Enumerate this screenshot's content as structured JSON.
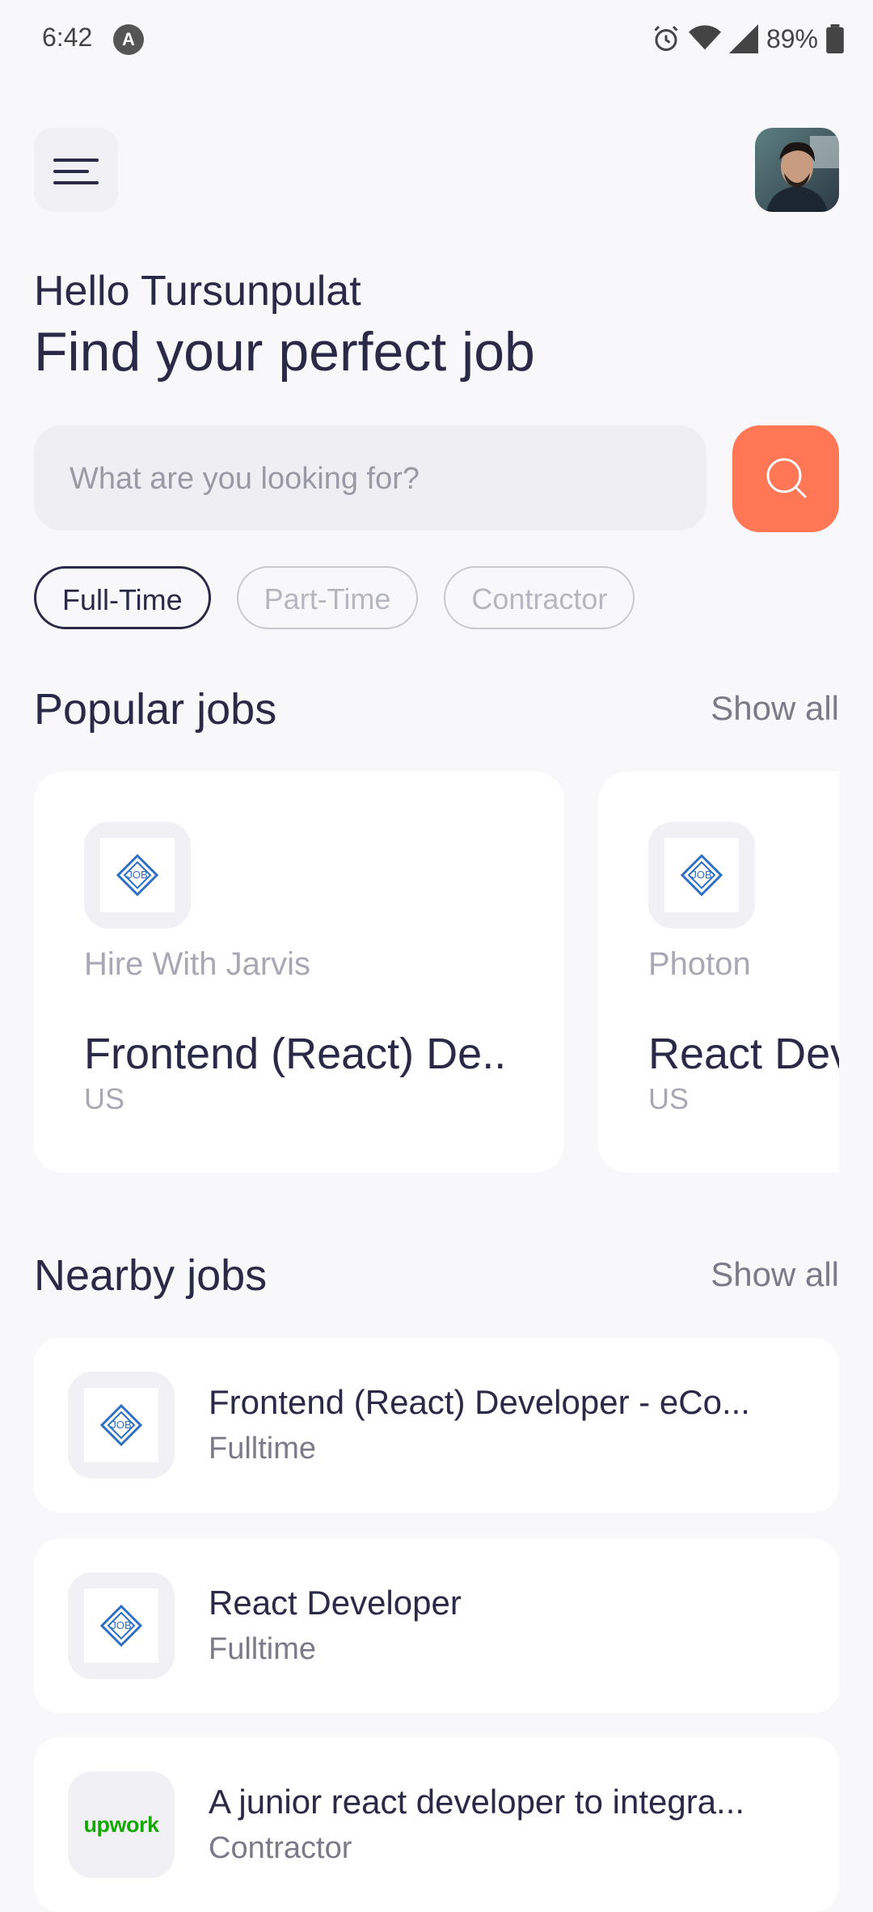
{
  "status_bar": {
    "time": "6:42",
    "battery": "89%"
  },
  "greeting": "Hello Tursunpulat",
  "headline": "Find your perfect job",
  "search": {
    "placeholder": "What are you looking for?"
  },
  "job_types": [
    {
      "label": "Full-Time",
      "active": true
    },
    {
      "label": "Part-Time",
      "active": false
    },
    {
      "label": "Contractor",
      "active": false
    }
  ],
  "popular": {
    "title": "Popular jobs",
    "show_all": "Show all",
    "cards": [
      {
        "company": "Hire With Jarvis",
        "title": "Frontend (React) De..",
        "location": "US"
      },
      {
        "company": "Photon",
        "title": "React Developer",
        "location": "US"
      }
    ]
  },
  "nearby": {
    "title": "Nearby jobs",
    "show_all": "Show all",
    "items": [
      {
        "title": "Frontend (React) Developer - eCo...",
        "type": "Fulltime",
        "logo": "job-logo"
      },
      {
        "title": "React Developer",
        "type": "Fulltime",
        "logo": "job-logo"
      },
      {
        "title": "A junior react developer to integra...",
        "type": "Contractor",
        "logo": "upwork",
        "logo_text": "upwork"
      }
    ]
  },
  "colors": {
    "accent": "#FF7754",
    "text": "#2A2947",
    "background": "#F8F8FB"
  }
}
